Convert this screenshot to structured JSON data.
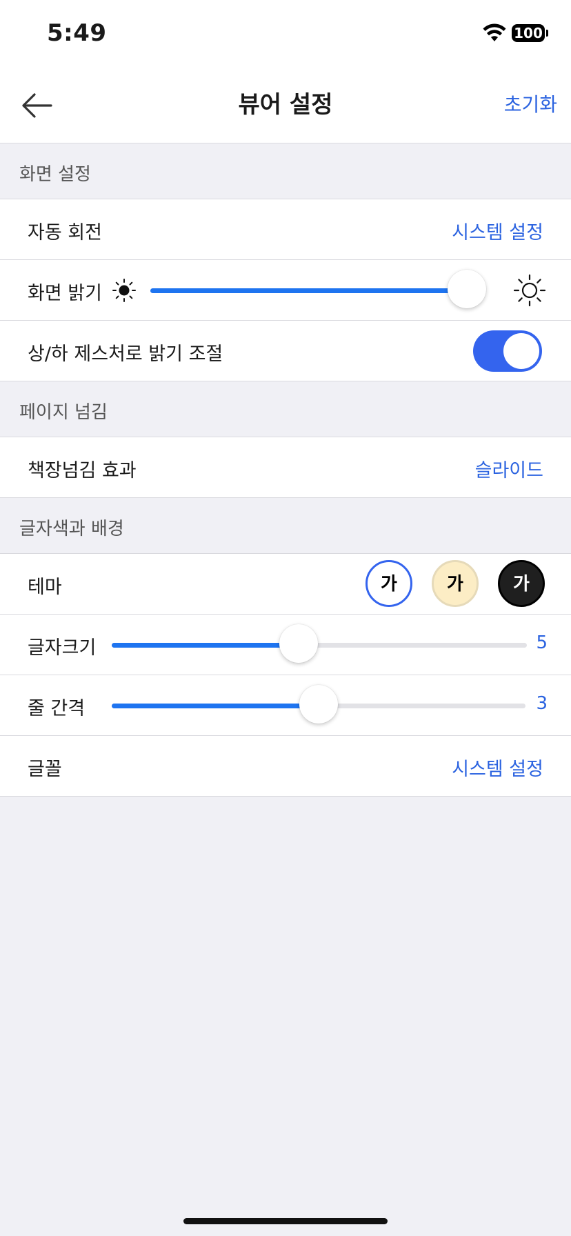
{
  "status_bar": {
    "time": "5:49",
    "battery": "100"
  },
  "nav": {
    "title": "뷰어 설정",
    "reset_label": "초기화"
  },
  "sections": {
    "screen": "화면 설정",
    "page_turn": "페이지 넘김",
    "text_bg": "글자색과 배경"
  },
  "rows": {
    "auto_rotate": {
      "label": "자동 회전",
      "value": "시스템 설정"
    },
    "brightness": {
      "label": "화면 밝기",
      "level": 0.96
    },
    "gesture_brightness": {
      "label": "상/하 제스처로 밝기 조절",
      "enabled": true
    },
    "page_effect": {
      "label": "책장넘김 효과",
      "value": "슬라이드"
    },
    "theme": {
      "label": "테마",
      "options": [
        {
          "glyph": "가",
          "selected": true,
          "bg": "#FFFFFF",
          "fg": "#000000",
          "border": "#3464EE"
        },
        {
          "glyph": "가",
          "selected": false,
          "bg": "#FCEDC5",
          "fg": "#000000",
          "border": "#E6DAB9"
        },
        {
          "glyph": "가",
          "selected": false,
          "bg": "#1F1F1F",
          "fg": "#FFFFFF",
          "border": "#000000"
        }
      ]
    },
    "font_size": {
      "label": "글자크기",
      "value": "5",
      "level": 0.45
    },
    "line_spacing": {
      "label": "줄 간격",
      "value": "3",
      "level": 0.5
    },
    "font": {
      "label": "글꼴",
      "value": "시스템 설정"
    }
  },
  "colors": {
    "accent": "#2B63E0",
    "slider": "#1E74F0",
    "toggle": "#3464EE"
  },
  "icons": {
    "back": "arrow-left-icon",
    "sun_small": "sun-filled-icon",
    "sun_large": "sun-outline-icon",
    "wifi": "wifi-icon",
    "battery": "battery-icon"
  }
}
